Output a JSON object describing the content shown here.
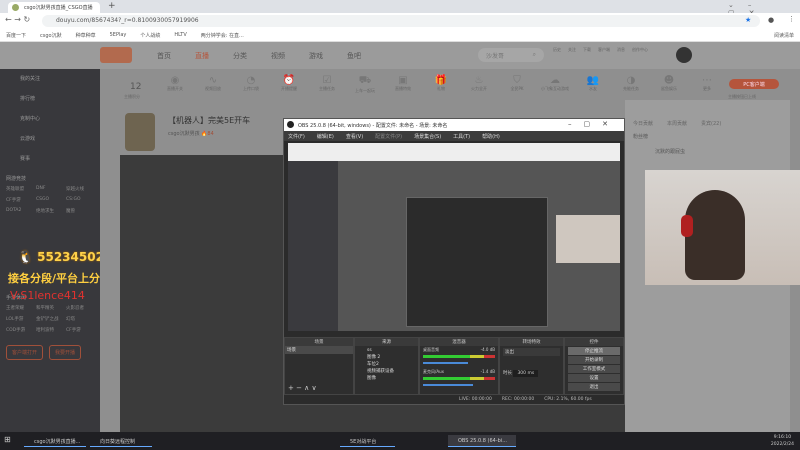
{
  "browser": {
    "tab_title": "csgo沉默男孩直播_CSGO直播",
    "url": "douyu.com/8567434?_r=0.8100930057919906",
    "bookmarks": [
      "百度一下",
      "csgo沉默",
      "种草种草",
      "5EPlay",
      "个人战绩",
      "HLTV",
      "两分钟学会: 在直..."
    ],
    "reading_list": "阅读清单"
  },
  "site": {
    "nav": [
      "首页",
      "直播",
      "分类",
      "视频",
      "游戏",
      "鱼吧"
    ],
    "search_placeholder": "沙发哥",
    "header_icons": [
      "历史",
      "关注",
      "下载",
      "客户端",
      "消息",
      "创作中心"
    ],
    "room_stats": {
      "count": "12",
      "label": "主播积分"
    },
    "room_icons": [
      "直播开关",
      "视频回放",
      "上传口袋",
      "开播提醒",
      "主播任务",
      "上车一起玩",
      "直播特效",
      "礼物",
      "火力全开",
      "全民PK",
      "小飞象互动游戏",
      "水友",
      "充能任务",
      "鲨鱼娱乐",
      "更多"
    ],
    "pc_button": "PC客户端",
    "pc_sub": "主播按钮已上线",
    "room_title": "【机器人】完美5E开车",
    "streamer": "csgo沉默男孩",
    "hot": "84",
    "rank_tabs": [
      "今日贡献",
      "本周贡献",
      "贵宾(22)"
    ],
    "rank_title": "粉丝榜",
    "rank_user": "沉默的跟屁虫"
  },
  "sidebar": {
    "items": [
      "我的关注",
      "排行榜",
      "克制中心",
      "云游戏",
      "赛事"
    ],
    "section1": "网游竞技",
    "games1": [
      "英雄联盟",
      "DNF",
      "穿越火线",
      "CF手游",
      "CSGO",
      "CS:GO",
      "DOTA2",
      "绝地求生",
      "魔兽"
    ],
    "section2": "手游休闲",
    "games2": [
      "王者荣耀",
      "和平精英",
      "火影忍者",
      "LOL手游",
      "金铲铲之战",
      "幻塔",
      "COD手游",
      "哈利波特",
      "CF手游"
    ],
    "btn_client": "客户端打开",
    "btn_live": "我要开播"
  },
  "overlay": {
    "qq": "55234502",
    "line1": "接各分段/平台上分",
    "line2": "V:S1lence414"
  },
  "obs": {
    "title": "OBS 25.0.8 (64-bit, windows) - 配置文件: 未命名 - 场景: 未命名",
    "menu": [
      "文件(F)",
      "编辑(E)",
      "查看(V)",
      "配置文件(P)",
      "场景集合(S)",
      "工具(T)",
      "帮助(H)"
    ],
    "docks": {
      "scenes": "场景",
      "sources": "来源",
      "mixer": "混音器",
      "transitions": "转场特效",
      "controls": "控件"
    },
    "scene_item": "场景",
    "sources": [
      "ss",
      "图像 2",
      "车位2",
      "视频捕获设备",
      "图像"
    ],
    "mixer": [
      {
        "name": "桌面音频",
        "db": "-4.0 dB"
      },
      {
        "name": "麦克风/Aux",
        "db": "-1.4 dB"
      }
    ],
    "transition": "淡出",
    "duration_label": "时长",
    "duration": "300 ms",
    "controls": [
      "停止推流",
      "开始录制",
      "工作室模式",
      "设置",
      "退出"
    ],
    "status": {
      "live": "LIVE: 00:00:00",
      "rec": "REC: 00:00:00",
      "cpu": "CPU: 2.1%, 60.00 fps"
    }
  },
  "taskbar": {
    "items": [
      "csgo沉默男孩直播...",
      "向日葵远程控制",
      "5E对战平台",
      "OBS 25.0.8 (64-bi..."
    ],
    "time": "9:16:10",
    "date": "2022/2/24"
  }
}
